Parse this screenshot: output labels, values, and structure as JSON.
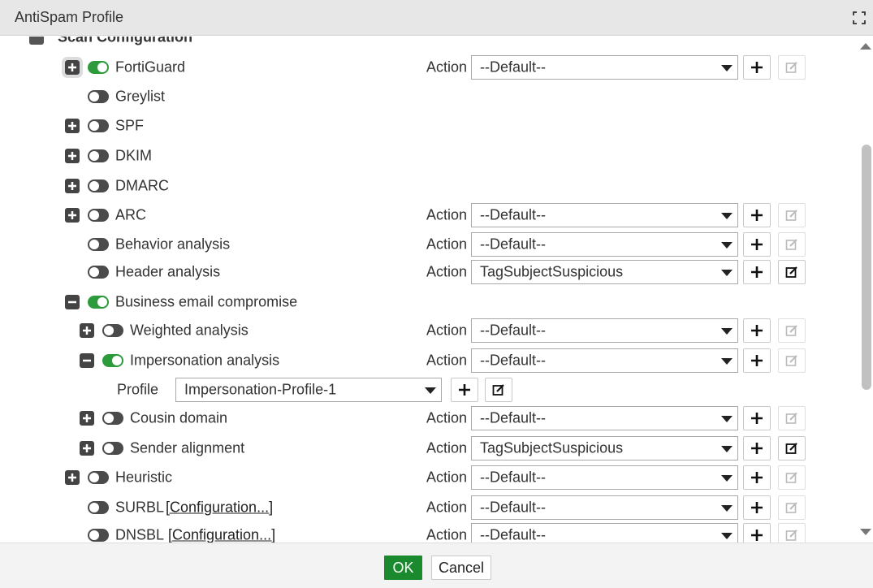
{
  "dialog": {
    "title": "AntiSpam Profile"
  },
  "section": {
    "label": "Scan Configuration"
  },
  "action_label": "Action",
  "profile_label": "Profile",
  "rows": {
    "fortiguard": {
      "label": "FortiGuard",
      "toggle": "on",
      "action": "--Default--"
    },
    "greylist": {
      "label": "Greylist",
      "toggle": "off"
    },
    "spf": {
      "label": "SPF",
      "toggle": "off"
    },
    "dkim": {
      "label": "DKIM",
      "toggle": "off"
    },
    "dmarc": {
      "label": "DMARC",
      "toggle": "off"
    },
    "arc": {
      "label": "ARC",
      "toggle": "off",
      "action": "--Default--"
    },
    "behavior": {
      "label": "Behavior analysis",
      "toggle": "off",
      "action": "--Default--"
    },
    "header": {
      "label": "Header analysis",
      "toggle": "off",
      "action": "TagSubjectSuspicious"
    },
    "bec": {
      "label": "Business email compromise",
      "toggle": "on"
    },
    "weighted": {
      "label": "Weighted analysis",
      "toggle": "off",
      "action": "--Default--"
    },
    "impersonation": {
      "label": "Impersonation analysis",
      "toggle": "on",
      "action": "--Default--",
      "profile": "Impersonation-Profile-1"
    },
    "cousin": {
      "label": "Cousin domain",
      "toggle": "off",
      "action": "--Default--"
    },
    "sender": {
      "label": "Sender alignment",
      "toggle": "off",
      "action": "TagSubjectSuspicious"
    },
    "heuristic": {
      "label": "Heuristic",
      "toggle": "off",
      "action": "--Default--"
    },
    "surbl": {
      "label": "SURBL",
      "link": "[Configuration...]",
      "toggle": "off",
      "action": "--Default--"
    },
    "dnsbl": {
      "label": "DNSBL",
      "link": "[Configuration...]",
      "toggle": "off",
      "action": "--Default--"
    }
  },
  "footer": {
    "ok_label": "OK",
    "cancel_label": "Cancel"
  },
  "colors": {
    "ok_green": "#1b8a2e",
    "toggle_on": "#2d9b3c",
    "toggle_off": "#4b4b4b",
    "titlebar": "#e7e7e7"
  }
}
